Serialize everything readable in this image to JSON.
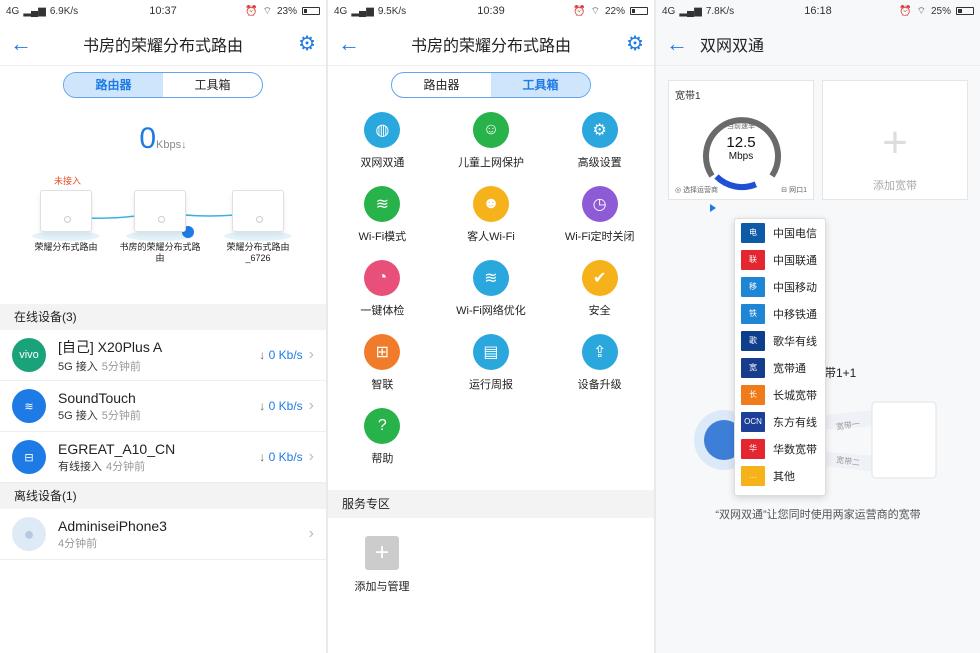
{
  "panel1": {
    "status": {
      "network": "4G",
      "speed": "6.9K/s",
      "time": "10:37",
      "battery": "23%",
      "battery_level": 0.23
    },
    "title": "书房的荣耀分布式路由",
    "tabs": [
      {
        "label": "路由器",
        "active": true
      },
      {
        "label": "工具箱",
        "active": false
      }
    ],
    "speed_value": "0",
    "speed_unit": "Kbps↓",
    "topology": {
      "warning": "未接入",
      "routers": [
        {
          "label": "荣耀分布式路由"
        },
        {
          "label": "书房的荣耀分布式路由"
        },
        {
          "label": "荣耀分布式路由_6726"
        }
      ]
    },
    "online_header": "在线设备(3)",
    "online_devices": [
      {
        "avatar": "vivo",
        "avatar_color": "#1aa37a",
        "name": "[自己] X20Plus A",
        "access": "5G 接入",
        "time": "5分钟前",
        "rate": "0 Kb/s",
        "icon": "vivo-logo-icon"
      },
      {
        "avatar": "",
        "avatar_color": "#1e7be5",
        "name": "SoundTouch",
        "access": "5G 接入",
        "time": "5分钟前",
        "rate": "0 Kb/s",
        "icon": "wifi-icon"
      },
      {
        "avatar": "",
        "avatar_color": "#1e7be5",
        "name": "EGREAT_A10_CN",
        "access": "有线接入",
        "time": "4分钟前",
        "rate": "0 Kb/s",
        "icon": "ethernet-icon"
      }
    ],
    "offline_header": "离线设备(1)",
    "offline_devices": [
      {
        "avatar": "",
        "avatar_color": "#dfeaf7",
        "name": "AdminiseiPhone3",
        "time": "4分钟前",
        "icon": "apple-icon"
      }
    ]
  },
  "panel2": {
    "status": {
      "network": "4G",
      "speed": "9.5K/s",
      "time": "10:39",
      "battery": "22%",
      "battery_level": 0.22
    },
    "title": "书房的荣耀分布式路由",
    "tabs": [
      {
        "label": "路由器",
        "active": false
      },
      {
        "label": "工具箱",
        "active": true
      }
    ],
    "tools": [
      {
        "label": "双网双通",
        "color": "#2aa8dd",
        "icon": "globe-icon",
        "glyph": "◍"
      },
      {
        "label": "儿童上网保护",
        "color": "#27b24a",
        "icon": "child-icon",
        "glyph": "☺"
      },
      {
        "label": "高级设置",
        "color": "#2aa8dd",
        "icon": "gears-icon",
        "glyph": "⚙"
      },
      {
        "label": "Wi-Fi模式",
        "color": "#27b24a",
        "icon": "wifi-icon",
        "glyph": "≋"
      },
      {
        "label": "客人Wi-Fi",
        "color": "#f5b21b",
        "icon": "guest-icon",
        "glyph": "☻"
      },
      {
        "label": "Wi-Fi定时关闭",
        "color": "#8e5bd6",
        "icon": "wifi-timer-icon",
        "glyph": "◷"
      },
      {
        "label": "一键体检",
        "color": "#e8507a",
        "icon": "checkup-icon",
        "glyph": "◔"
      },
      {
        "label": "Wi-Fi网络优化",
        "color": "#2aa8dd",
        "icon": "wifi-optimize-icon",
        "glyph": "≋"
      },
      {
        "label": "安全",
        "color": "#f5b21b",
        "icon": "shield-icon",
        "glyph": "✔"
      },
      {
        "label": "智联",
        "color": "#f07b2a",
        "icon": "network-icon",
        "glyph": "⊞"
      },
      {
        "label": "运行周报",
        "color": "#2aa8dd",
        "icon": "report-icon",
        "glyph": "▤"
      },
      {
        "label": "设备升级",
        "color": "#2aa8dd",
        "icon": "upgrade-icon",
        "glyph": "⇪"
      },
      {
        "label": "帮助",
        "color": "#27b24a",
        "icon": "help-icon",
        "glyph": "?"
      }
    ],
    "service_header": "服务专区",
    "add_label": "添加与管理"
  },
  "panel3": {
    "status": {
      "network": "4G",
      "speed": "7.8K/s",
      "time": "16:18",
      "battery": "25%",
      "battery_level": 0.25
    },
    "title": "双网双通",
    "card1": {
      "title": "宽带1",
      "speed_key": "当前速率",
      "speed_value": "12.5",
      "speed_unit": "Mbps",
      "gauge_level": 0.25,
      "left_foot": "选择运营商",
      "right_foot": "网口1"
    },
    "card2": {
      "label": "添加宽带"
    },
    "isps": [
      {
        "name": "中国电信",
        "color": "#0d5aa7",
        "glyph": "电"
      },
      {
        "name": "中国联通",
        "color": "#e3262f",
        "glyph": "联"
      },
      {
        "name": "中国移动",
        "color": "#1f86d6",
        "glyph": "移"
      },
      {
        "name": "中移铁通",
        "color": "#1f86d6",
        "glyph": "铁"
      },
      {
        "name": "歌华有线",
        "color": "#0d3f8c",
        "glyph": "歌"
      },
      {
        "name": "宽带通",
        "color": "#173c8c",
        "glyph": "宽"
      },
      {
        "name": "长城宽带",
        "color": "#f07b1a",
        "glyph": "长"
      },
      {
        "name": "东方有线",
        "color": "#1d3f99",
        "glyph": "OCN"
      },
      {
        "name": "华数宽带",
        "color": "#e3262f",
        "glyph": "华"
      },
      {
        "name": "其他",
        "color": "#f5b21b",
        "glyph": "…"
      }
    ],
    "behind_text": "带1+1",
    "line_labels": [
      "宽带一",
      "宽带二"
    ],
    "caption": "“双网双通”让您同时使用两家运营商的宽带"
  }
}
